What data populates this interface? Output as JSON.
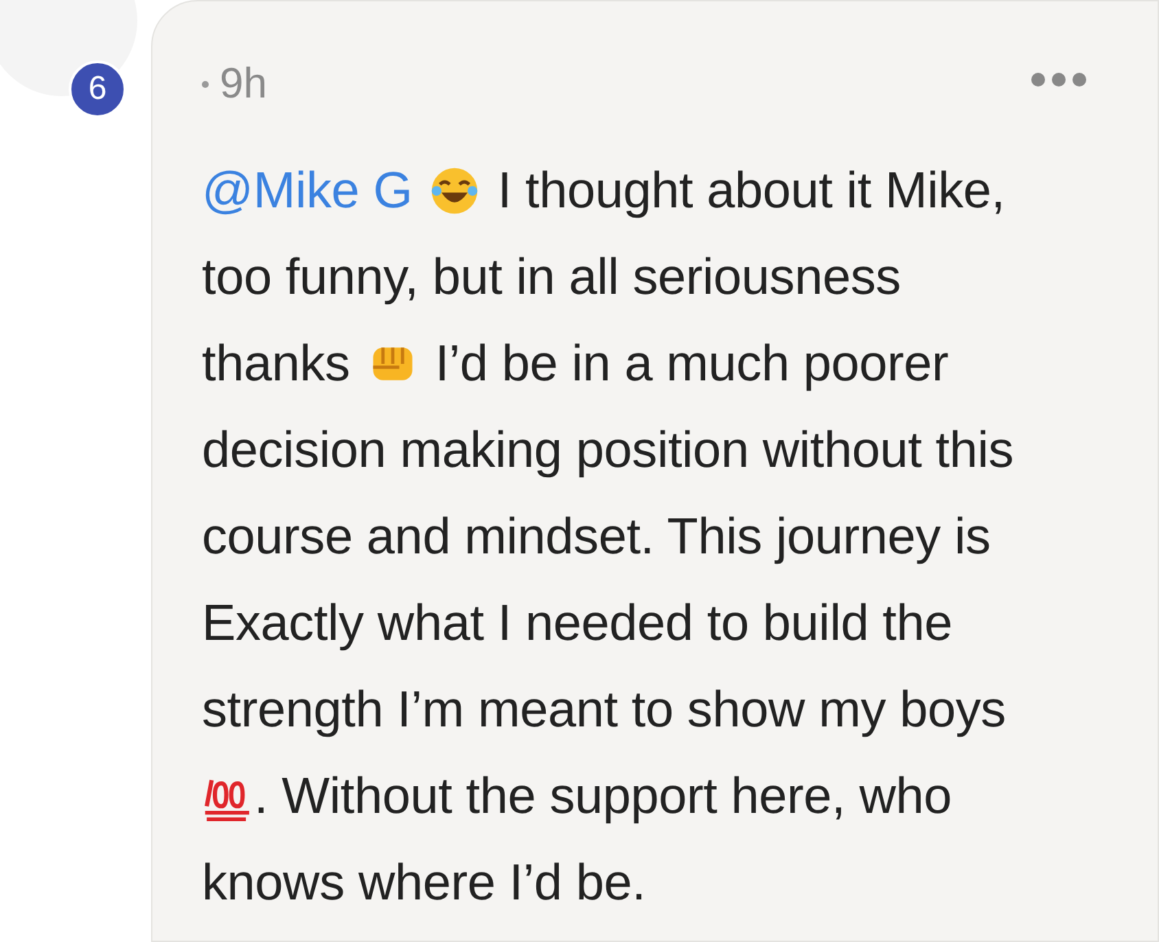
{
  "author": {
    "badge": "6",
    "time": "9h"
  },
  "comment": {
    "lines": [
      [
        {
          "kind": "mention",
          "text": "@Mike G"
        },
        {
          "kind": "laugh-emoji"
        },
        {
          "kind": "text",
          "text": "I thought about it Mike,"
        }
      ],
      [
        {
          "kind": "text",
          "text": "too funny, but in all seriousness"
        }
      ],
      [
        {
          "kind": "text",
          "text": "thanks"
        },
        {
          "kind": "fist-emoji"
        },
        {
          "kind": "text",
          "text": "I’d be in a much poorer"
        }
      ],
      [
        {
          "kind": "text",
          "text": "decision making position without this"
        }
      ],
      [
        {
          "kind": "text",
          "text": "course and mindset. This journey is"
        }
      ],
      [
        {
          "kind": "text",
          "text": "Exactly what I needed to build the"
        }
      ],
      [
        {
          "kind": "text",
          "text": "strength I’m meant to show my boys"
        }
      ],
      [
        {
          "kind": "hundred-emoji"
        },
        {
          "kind": "text",
          "text": ". Without the support here, who"
        }
      ],
      [
        {
          "kind": "text",
          "text": "knows where I’d be."
        }
      ]
    ]
  }
}
